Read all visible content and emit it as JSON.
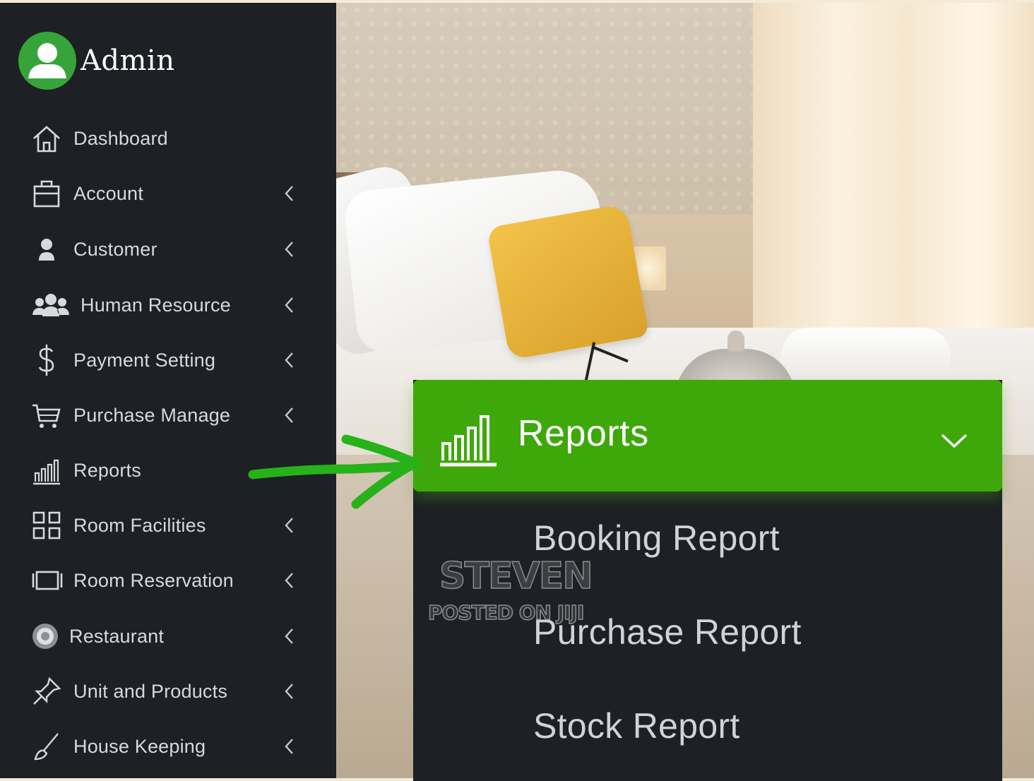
{
  "sidebar": {
    "user": {
      "name": "Admin"
    },
    "items": [
      {
        "label": "Dashboard",
        "icon": "home-icon",
        "chevron": false
      },
      {
        "label": "Account",
        "icon": "briefcase-icon",
        "chevron": true
      },
      {
        "label": "Customer",
        "icon": "user-icon",
        "chevron": true
      },
      {
        "label": "Human Resource",
        "icon": "users-icon",
        "chevron": true
      },
      {
        "label": "Payment Setting",
        "icon": "dollar-icon",
        "chevron": true
      },
      {
        "label": "Purchase Manage",
        "icon": "cart-icon",
        "chevron": true
      },
      {
        "label": "Reports",
        "icon": "bar-chart-icon",
        "chevron": false
      },
      {
        "label": "Room Facilities",
        "icon": "grid-icon",
        "chevron": true
      },
      {
        "label": "Room Reservation",
        "icon": "reservation-icon",
        "chevron": true
      },
      {
        "label": "Restaurant",
        "icon": "restaurant-icon",
        "chevron": true
      },
      {
        "label": "Unit and Products",
        "icon": "pin-icon",
        "chevron": true
      },
      {
        "label": "House Keeping",
        "icon": "broom-icon",
        "chevron": true
      }
    ]
  },
  "reports_panel": {
    "title": "Reports",
    "items": [
      "Booking Report",
      "Purchase Report",
      "Stock Report"
    ]
  },
  "watermark": {
    "name": "STEVEN",
    "posted": "POSTED ON JIJI"
  },
  "colors": {
    "sidebar_bg": "#1d2024",
    "accent_green": "#3ea80b",
    "text": "#d7d9dc"
  }
}
